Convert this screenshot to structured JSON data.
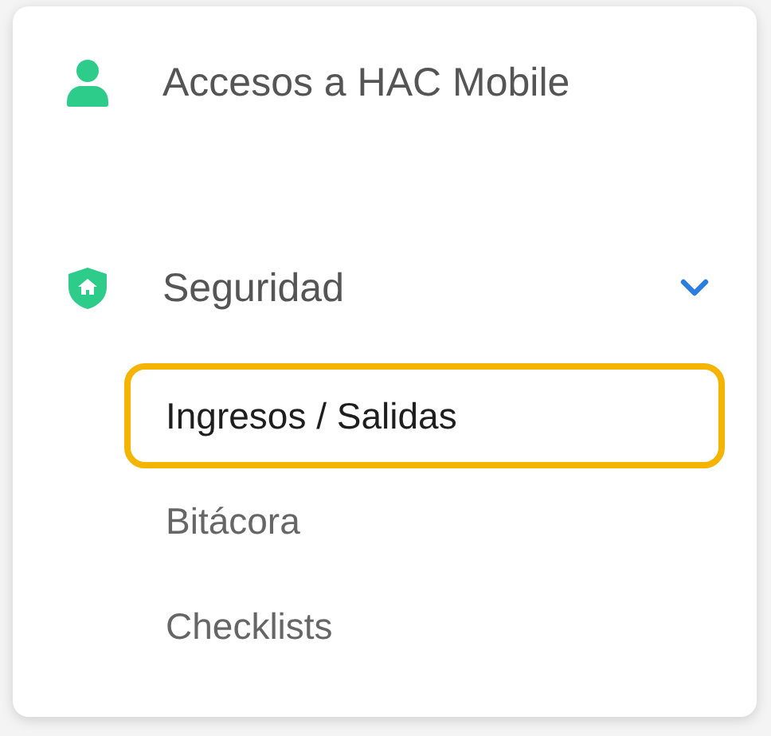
{
  "menu": {
    "items": [
      {
        "label": "Accesos a HAC Mobile"
      },
      {
        "label": "Seguridad",
        "expanded": true,
        "children": [
          {
            "label": "Ingresos / Salidas",
            "selected": true
          },
          {
            "label": "Bitácora",
            "selected": false
          },
          {
            "label": "Checklists",
            "selected": false
          }
        ]
      }
    ]
  }
}
